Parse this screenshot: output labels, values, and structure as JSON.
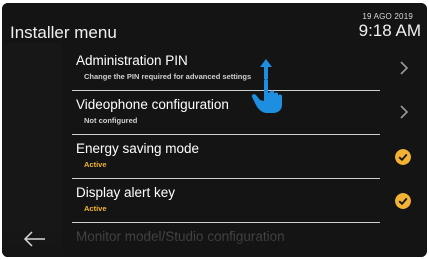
{
  "header": {
    "title": "Installer menu",
    "date": "19 AGO 2019",
    "time": "9:18 AM"
  },
  "menu": {
    "items": [
      {
        "label": "Administration PIN",
        "sublabel": "Change the PIN required for advanced settings",
        "action": "chevron-right-icon"
      },
      {
        "label": "Videophone configuration",
        "sublabel": "Not configured",
        "action": "chevron-right-icon"
      },
      {
        "label": "Energy saving mode",
        "sublabel": "Active",
        "action": "check-circle-icon"
      },
      {
        "label": "Display alert key",
        "sublabel": "Active",
        "action": "check-circle-icon"
      },
      {
        "label": "Monitor model/Studio configuration",
        "sublabel": "",
        "action": ""
      }
    ]
  },
  "nav": {
    "back_icon": "back-arrow-icon"
  },
  "gesture": {
    "icon": "swipe-up-hand-icon"
  },
  "colors": {
    "background": "#141414",
    "accent": "#f2b233",
    "text": "#ffffff",
    "divider": "#cfcfcf",
    "gesture": "#1e8fe0"
  }
}
